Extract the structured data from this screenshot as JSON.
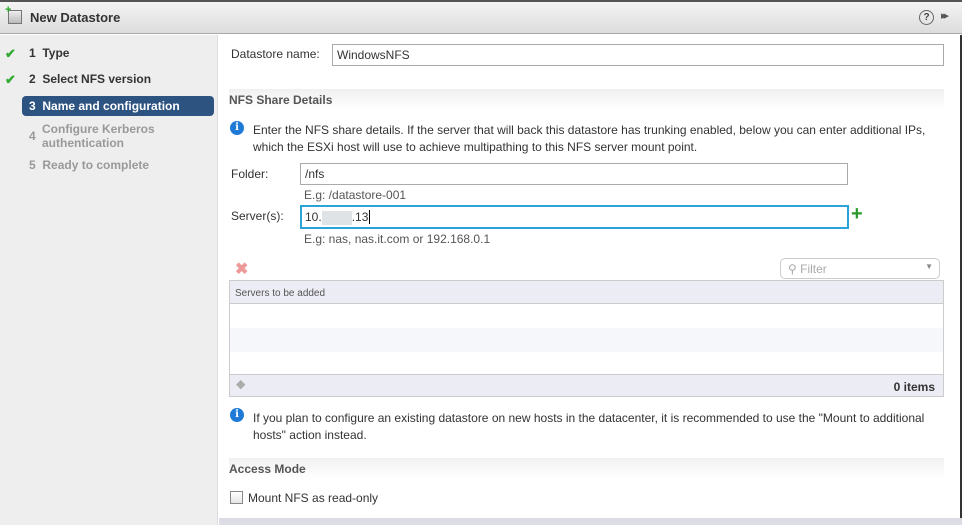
{
  "window": {
    "title": "New Datastore",
    "help_icon": "?",
    "forward_icon": "▸▸"
  },
  "steps": [
    {
      "num": "1",
      "label": "Type",
      "state": "done"
    },
    {
      "num": "2",
      "label": "Select NFS version",
      "state": "done"
    },
    {
      "num": "3",
      "label": "Name and configuration",
      "state": "active"
    },
    {
      "num": "4",
      "label": "Configure Kerberos authentication",
      "state": "todo"
    },
    {
      "num": "5",
      "label": "Ready to complete",
      "state": "todo"
    }
  ],
  "form": {
    "name_label": "Datastore name:",
    "name_value": "WindowsNFS",
    "nfs_section": "NFS Share Details",
    "nfs_info": "Enter the NFS share details. If the server that will back this datastore has trunking enabled, below you can enter additional IPs, which the ESXi host will use to achieve multipathing to this NFS server mount point.",
    "folder_label": "Folder:",
    "folder_value": "/nfs",
    "folder_hint": "E.g: /datastore-001",
    "server_label": "Server(s):",
    "server_value_prefix": "10.",
    "server_value_suffix": ".13",
    "server_hint": "E.g: nas, nas.it.com or 192.168.0.1",
    "filter_placeholder": "Filter",
    "grid_header": "Servers to be added",
    "grid_count": "0 items",
    "mount_info": "If you plan to configure an existing datastore on new hosts in the datacenter, it is recommended to use the \"Mount to additional hosts\" action instead.",
    "access_section": "Access Mode",
    "readonly_label": "Mount NFS as read-only",
    "readonly_checked": false
  },
  "colors": {
    "active_step": "#2d5380",
    "focus_border": "#29a3d8",
    "check": "#33aa33",
    "add": "#2a9a2a",
    "remove": "#e88"
  }
}
